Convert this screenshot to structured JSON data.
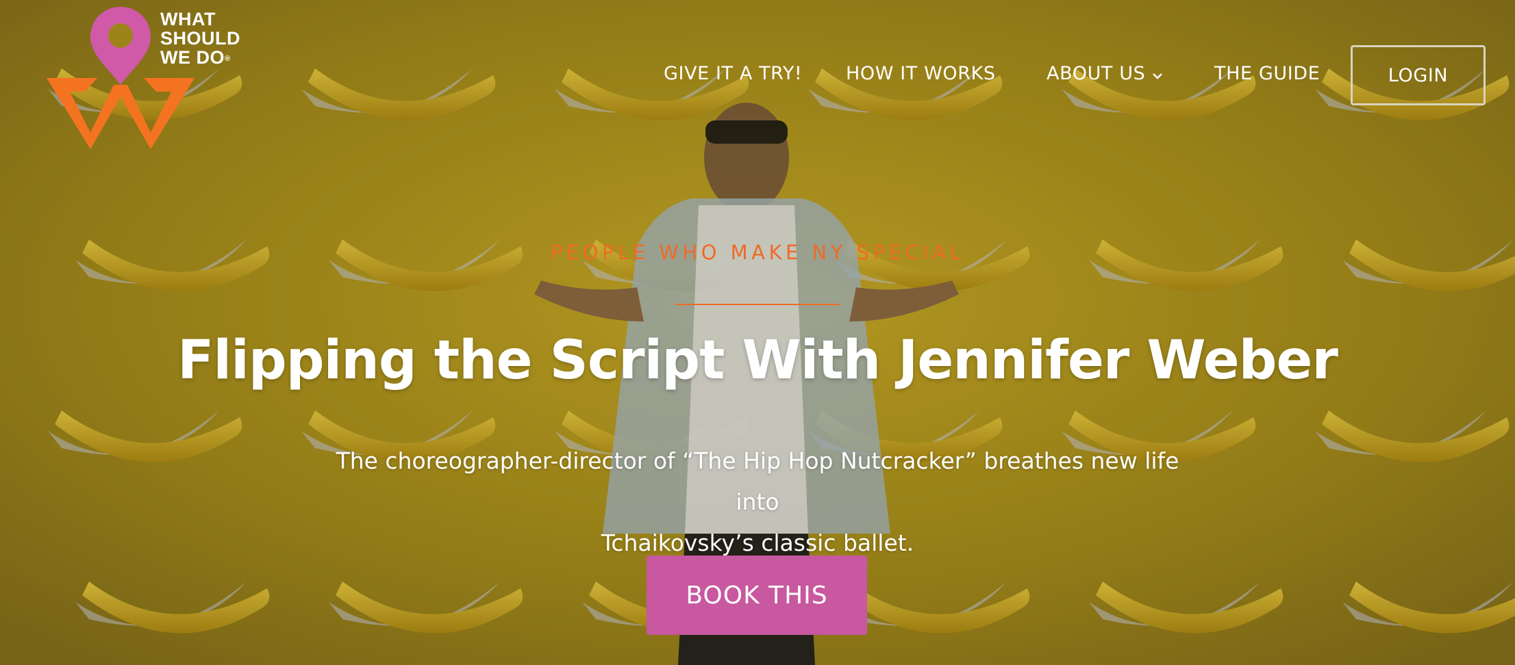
{
  "brand": {
    "name_lines": [
      "WHAT",
      "SHOULD",
      "WE DO"
    ],
    "registered_mark": "®",
    "colors": {
      "pin": "#d059a8",
      "mark": "#f47321"
    },
    "icon": "location-pin-logo"
  },
  "nav": {
    "items": [
      {
        "label": "GIVE IT A TRY!"
      },
      {
        "label": "HOW IT WORKS"
      },
      {
        "label": "ABOUT US",
        "icon": "chevron-down-icon"
      },
      {
        "label": "THE GUIDE"
      }
    ],
    "login_label": "LOGIN"
  },
  "hero": {
    "eyebrow": "PEOPLE WHO MAKE NY SPECIAL",
    "title": "Flipping the Script With Jennifer Weber",
    "subtitle_lines": [
      "The choreographer-director of “The Hip Hop Nutcracker” breathes new life into",
      "Tchaikovsky’s classic ballet."
    ],
    "cta_label": "BOOK THIS",
    "colors": {
      "eyebrow": "#ee6b26",
      "cta": "#c8589f",
      "background": "#a98f1c"
    }
  }
}
